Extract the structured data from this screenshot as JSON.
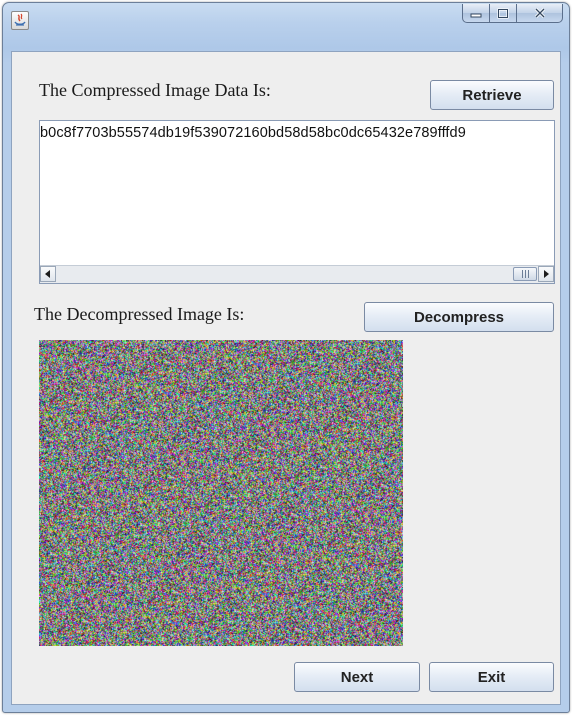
{
  "window": {
    "title": "",
    "controls": [
      "minimize-icon",
      "maximize-icon",
      "close-icon"
    ]
  },
  "compressed_section": {
    "label": "The Compressed Image Data Is:",
    "retrieve_label": "Retrieve",
    "data_text": "b0c8f7703b55574db19f539072160bd58d58bc0dc65432e789fffd9",
    "scroll_position": 1.0
  },
  "decompressed_section": {
    "label": "The Decompressed Image Is:",
    "decompress_label": "Decompress"
  },
  "footer": {
    "next_label": "Next",
    "exit_label": "Exit"
  },
  "colors": {
    "titlebar": "#b9d0ec",
    "panel": "#eeeeee",
    "button_top": "#fbfcfe",
    "button_bottom": "#d3dfee"
  }
}
